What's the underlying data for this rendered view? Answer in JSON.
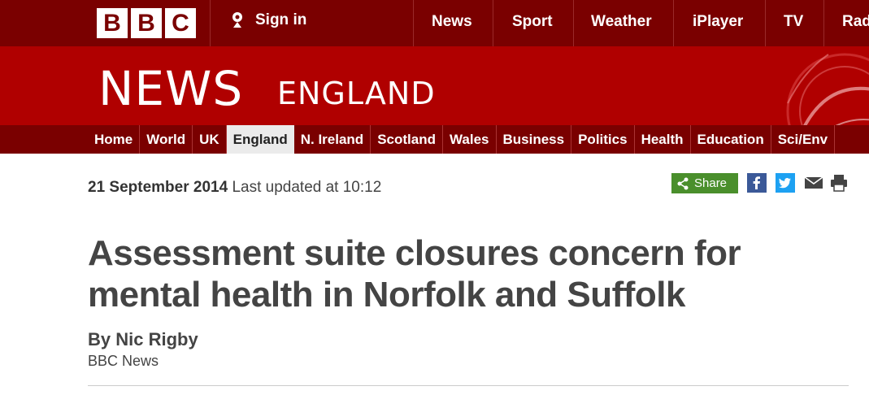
{
  "brand": {
    "letters": [
      "B",
      "B",
      "C"
    ]
  },
  "topbar": {
    "signin_label": "Sign in",
    "nav": [
      "News",
      "Sport",
      "Weather",
      "iPlayer",
      "TV",
      "Rad"
    ]
  },
  "banner": {
    "title": "NEWS",
    "subtitle": "ENGLAND"
  },
  "section_nav": {
    "items": [
      "Home",
      "World",
      "UK",
      "England",
      "N. Ireland",
      "Scotland",
      "Wales",
      "Business",
      "Politics",
      "Health",
      "Education",
      "Sci/Env"
    ],
    "active": "England"
  },
  "article": {
    "date": "21 September 2014",
    "updated": "Last updated at 10:12",
    "headline": "Assessment suite closures concern for mental health in Norfolk and Suffolk",
    "byline": "By Nic Rigby",
    "org": "BBC News"
  },
  "share": {
    "label": "Share",
    "icons": [
      "facebook-icon",
      "twitter-icon",
      "email-icon",
      "print-icon"
    ]
  },
  "colors": {
    "topbar": "#7a0000",
    "banner": "#b00000",
    "share_green": "#4a8f2c",
    "facebook": "#3b5998",
    "twitter": "#1da1f2"
  }
}
